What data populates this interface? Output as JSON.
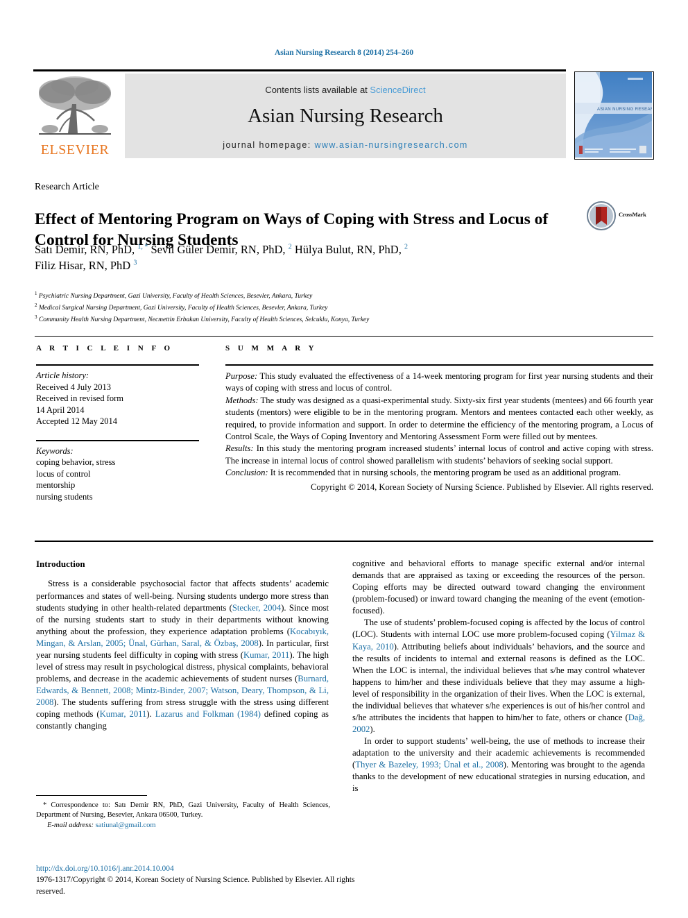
{
  "running_head": "Asian Nursing Research 8 (2014) 254–260",
  "masthead": {
    "publisher_name": "ELSEVIER",
    "contents_prefix": "Contents lists available at ",
    "contents_link": "ScienceDirect",
    "journal_title": "Asian Nursing Research",
    "homepage_prefix": "journal homepage: ",
    "homepage_url": "www.asian-nursingresearch.com",
    "cover_caption": "ASIAN NURSING RESEARCH"
  },
  "article": {
    "kicker": "Research Article",
    "title": "Effect of Mentoring Program on Ways of Coping with Stress and Locus of Control for Nursing Students",
    "crossmark_label": "CrossMark",
    "authors_line1_a": "Satı Demir, RN, PhD, ",
    "authors_line1_sup1": "1, *",
    "authors_line1_b": " Sevil Güler Demir, RN, PhD, ",
    "authors_line1_sup2": "2",
    "authors_line1_c": " Hülya Bulut, RN, PhD, ",
    "authors_line1_sup3": "2",
    "authors_line2": "Filiz Hisar, RN, PhD ",
    "authors_line2_sup": "3",
    "affiliations": [
      {
        "marker": "1",
        "text": "Psychiatric Nursing Department, Gazi University, Faculty of Health Sciences, Besevler, Ankara, Turkey"
      },
      {
        "marker": "2",
        "text": "Medical Surgical Nursing Department, Gazi University, Faculty of Health Sciences, Besevler, Ankara, Turkey"
      },
      {
        "marker": "3",
        "text": "Community Health Nursing Department, Necmettin Erbakan University, Faculty of Health Sciences, Selcuklu, Konya, Turkey"
      }
    ]
  },
  "article_info": {
    "heading": "A R T I C L E  I N F O",
    "history_label": "Article history:",
    "history_lines": [
      "Received 4 July 2013",
      "Received in revised form",
      "14 April 2014",
      "Accepted 12 May 2014"
    ],
    "keywords_label": "Keywords:",
    "keywords": [
      "coping behavior, stress",
      "locus of control",
      "mentorship",
      "nursing students"
    ]
  },
  "summary": {
    "heading": "S U M M A R Y",
    "sections": [
      {
        "label": "Purpose:",
        "text": " This study evaluated the effectiveness of a 14-week mentoring program for first year nursing students and their ways of coping with stress and locus of control."
      },
      {
        "label": "Methods:",
        "text": " The study was designed as a quasi-experimental study. Sixty-six first year students (mentees) and 66 fourth year students (mentors) were eligible to be in the mentoring program. Mentors and mentees contacted each other weekly, as required, to provide information and support. In order to determine the efficiency of the mentoring program, a Locus of Control Scale, the Ways of Coping Inventory and Mentoring Assessment Form were filled out by mentees."
      },
      {
        "label": "Results:",
        "text": " In this study the mentoring program increased students’ internal locus of control and active coping with stress. The increase in internal locus of control showed parallelism with students’ behaviors of seeking social support."
      },
      {
        "label": "Conclusion:",
        "text": " It is recommended that in nursing schools, the mentoring program be used as an additional program."
      }
    ],
    "copyright": "Copyright © 2014, Korean Society of Nursing Science. Published by Elsevier. All rights reserved."
  },
  "body": {
    "intro_heading": "Introduction",
    "left_paragraph_1_part1": "Stress is a considerable psychosocial factor that affects students’ academic performances and states of well-being. Nursing students undergo more stress than students studying in other health-related departments (",
    "left_ref_1": "Stecker, 2004",
    "left_paragraph_1_part2": "). Since most of the nursing students start to study in their departments without knowing anything about the profession, they experience adaptation problems (",
    "left_ref_2": "Kocabıyık, Mingan, & Arslan, 2005; Ünal, Gürhan, Saral, & Özbaş, 2008",
    "left_paragraph_1_part3": "). In particular, first year nursing students feel difficulty in coping with stress (",
    "left_ref_3": "Kumar, 2011",
    "left_paragraph_1_part4": "). The high level of stress may result in psychological distress, physical complaints, behavioral problems, and decrease in the academic achievements of student nurses (",
    "left_ref_4": "Burnard, Edwards, & Bennett, 2008; Mintz-Binder, 2007; Watson, Deary, Thompson, & Li, 2008",
    "left_paragraph_1_part5": "). The students suffering from stress struggle with the stress using different coping methods (",
    "left_ref_5": "Kumar, 2011",
    "left_paragraph_1_part6": "). ",
    "left_ref_6": "Lazarus and Folkman (1984)",
    "left_paragraph_1_part7": " defined coping as constantly changing",
    "right_paragraph_1": "cognitive and behavioral efforts to manage specific external and/or internal demands that are appraised as taxing or exceeding the resources of the person. Coping efforts may be directed outward toward changing the environment (problem-focused) or inward toward changing the meaning of the event (emotion-focused).",
    "right_paragraph_2_part1": "The use of students’ problem-focused coping is affected by the locus of control (LOC). Students with internal LOC use more problem-focused coping (",
    "right_ref_1": "Yilmaz & Kaya, 2010",
    "right_paragraph_2_part2": "). Attributing beliefs about individuals’ behaviors, and the source and the results of incidents to internal and external reasons is defined as the LOC. When the LOC is internal, the individual believes that s/he may control whatever happens to him/her and these individuals believe that they may assume a high-level of responsibility in the organization of their lives. When the LOC is external, the individual believes that whatever s/he experiences is out of his/her control and s/he attributes the incidents that happen to him/her to fate, others or chance (",
    "right_ref_2": "Dağ, 2002",
    "right_paragraph_2_part3": ").",
    "right_paragraph_3_part1": "In order to support students’ well-being, the use of methods to increase their adaptation to the university and their academic achievements is recommended (",
    "right_ref_3": "Thyer & Bazeley, 1993; Ünal et al., 2008",
    "right_paragraph_3_part2": "). Mentoring was brought to the agenda thanks to the development of new educational strategies in nursing education, and is"
  },
  "footnote": {
    "marker": "*",
    "correspondence": " Correspondence to: Satı Demir RN, PhD, Gazi University, Faculty of Health Sciences, Department of Nursing, Besevler, Ankara 06500, Turkey.",
    "email_label": "E-mail address:",
    "email": " satiunal@gmail.com",
    "doi": "http://dx.doi.org/10.1016/j.anr.2014.10.004",
    "issn_line": "1976-1317/Copyright © 2014, Korean Society of Nursing Science. Published by Elsevier. All rights reserved."
  },
  "colors": {
    "link_blue": "#1c6fa4",
    "sciencedirect_blue": "#4a9cd6",
    "elsevier_orange": "#e87722",
    "band_grey": "#e3e3e3"
  }
}
